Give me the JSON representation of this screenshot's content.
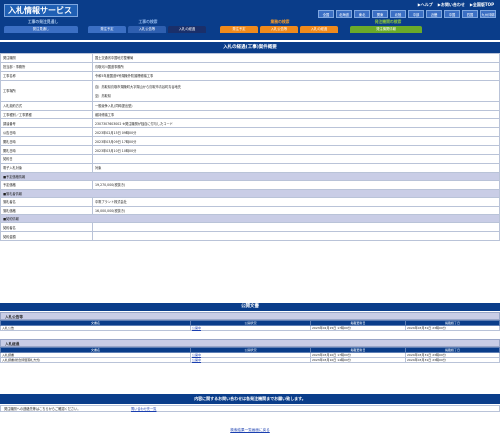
{
  "header": {
    "title": "入札情報サービス",
    "links": [
      "▶ヘルプ",
      "▶お問い合わせ",
      "▶全国版TOP"
    ],
    "regions": [
      "全国",
      "北海道",
      "東北",
      "関東",
      "北陸",
      "中部",
      "近畿",
      "中国",
      "四国",
      "九州沖縄"
    ],
    "categories": [
      {
        "title": "工事の発注見通し",
        "color": "#a9c7ec",
        "tabs": [
          {
            "label": "発注見通し",
            "color": "#3b6fc4"
          }
        ]
      },
      {
        "title": "工事の検索",
        "color": "#8db4ea",
        "tabs": [
          {
            "label": "発注予定",
            "color": "#3b6fc4"
          },
          {
            "label": "入札公告等",
            "color": "#2e5fb0"
          },
          {
            "label": "入札の経過",
            "color": "#1a2f6a"
          }
        ]
      },
      {
        "title": "業務の検索",
        "color": "#f59b2b",
        "tabs": [
          {
            "label": "発注予定",
            "color": "#f08a1c"
          },
          {
            "label": "入札公告等",
            "color": "#f08a1c"
          },
          {
            "label": "入札の経過",
            "color": "#f08a1c"
          }
        ]
      },
      {
        "title": "発注機関の検索",
        "color": "#8cc63f",
        "tabs": [
          {
            "label": "発注機関情報",
            "color": "#6aaa2a"
          }
        ]
      }
    ]
  },
  "main": {
    "title": "入札の経過(工事)案件概要",
    "rows": [
      {
        "k": "発注機関",
        "v": "国土交通省中国地方整備局"
      },
      {
        "k": "担当部・事務所",
        "v": "鳥取河川国道事務所"
      },
      {
        "k": "工事名称",
        "v": "令和5年度国道9号湖陵外防護柵修繕工事"
      },
      {
        "k": "工事場所",
        "v": "自）鳥取県鳥取市湖陵町大字湖山から鳥取市青谷町青谷地先",
        "v2": "至）鳥取県"
      },
      {
        "k": "入札契約方式",
        "v": "一般競争入札(同時提出型)"
      },
      {
        "k": "工事種別／工事業種",
        "v": "維持修繕工事"
      },
      {
        "k": "調達番号",
        "v": "2307307603002   ※発注機関が独自に付与したコード"
      },
      {
        "k": "公告日時",
        "v": "2023年02月15日 09時00分"
      },
      {
        "k": "開札日時",
        "v": "2023年03月09日 17時00分"
      },
      {
        "k": "開札日時",
        "v": "2023年03月10日 10時00分"
      },
      {
        "k": "契約日",
        "v": ""
      },
      {
        "k": "電子入札対象",
        "v": "対象"
      }
    ],
    "groups": [
      {
        "title": "■予定価格情報",
        "rows": [
          {
            "k": "予定価格",
            "v": "19,270,000(税抜き)"
          }
        ]
      },
      {
        "title": "■落札者情報",
        "rows": [
          {
            "k": "落札者名",
            "v": "中電プラント株式会社"
          },
          {
            "k": "落札価格",
            "v": "16,000,000(税抜き)"
          }
        ]
      },
      {
        "title": "■契約情報",
        "rows": [
          {
            "k": "契約者名",
            "v": ""
          },
          {
            "k": "契約金額",
            "v": ""
          }
        ]
      }
    ]
  },
  "public_docs": {
    "title": "公開文書",
    "sections": [
      {
        "title": "入札公告等",
        "headers": [
          "文書名",
          "公開状況",
          "掲載更新日",
          "掲載終了日"
        ],
        "rows": [
          {
            "name": "入札公告",
            "status": "公開中",
            "updated": "2023年02月15日 17時00分",
            "end": "2024年03月31日 23時00分"
          }
        ]
      },
      {
        "title": "入札経過",
        "headers": [
          "文書名",
          "公開状況",
          "掲載更新日",
          "掲載終了日"
        ],
        "rows": [
          {
            "name": "入札調書",
            "status": "公開中",
            "updated": "2023年03月10日 17時00分",
            "end": "2024年03月31日 23時00分"
          },
          {
            "name": "入札調書(総合評価落札方式)",
            "status": "公開中",
            "updated": "2023年03月10日 14時00分",
            "end": "2024年03月31日 23時00分"
          }
        ]
      }
    ]
  },
  "notice": "内容に関するお問い合わせは各発注機関までお願い致します。",
  "contact": {
    "label": "発注機関への連絡先等はこちらからご確認ください。",
    "link": "問い合わせ先一覧"
  },
  "footer_link": "検索結果一覧画面に戻る"
}
